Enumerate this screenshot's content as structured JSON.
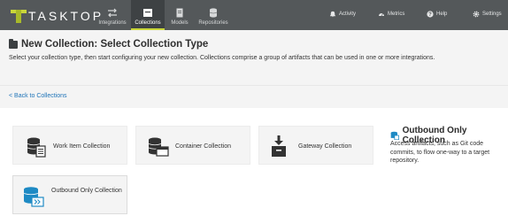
{
  "nav": {
    "logo_text": "TASKTOP",
    "tabs": [
      {
        "label": "Integrations",
        "icon": "arrows-icon"
      },
      {
        "label": "Collections",
        "icon": "folder-icon"
      },
      {
        "label": "Models",
        "icon": "document-icon"
      },
      {
        "label": "Repositories",
        "icon": "database-icon"
      }
    ],
    "right": [
      {
        "label": "Activity",
        "icon": "bell-icon"
      },
      {
        "label": "Metrics",
        "icon": "gauge-icon"
      },
      {
        "label": "Help",
        "icon": "question-icon"
      },
      {
        "label": "Settings",
        "icon": "gear-icon"
      }
    ]
  },
  "header": {
    "title": "New Collection: Select Collection Type",
    "description": "Select your collection type, then start configuring your new collection. Collections comprise a group of artifacts that can be used in one or more integrations."
  },
  "subbar": {
    "back_label": "< Back to Collections"
  },
  "cards": [
    {
      "label": "Work Item Collection",
      "icon": "work-item-collection-icon"
    },
    {
      "label": "Container Collection",
      "icon": "container-collection-icon"
    },
    {
      "label": "Gateway Collection",
      "icon": "gateway-collection-icon"
    },
    {
      "label": "Outbound Only Collection",
      "icon": "outbound-collection-icon"
    }
  ],
  "side": {
    "title": "Outbound Only Collection",
    "description": "Access artifacts, such as Git code commits, to flow one-way to a target repository."
  },
  "colors": {
    "nav_bg": "#54585a",
    "accent": "#c9d63a",
    "link": "#1f74b8",
    "outbound_blue": "#1e8ac4"
  }
}
